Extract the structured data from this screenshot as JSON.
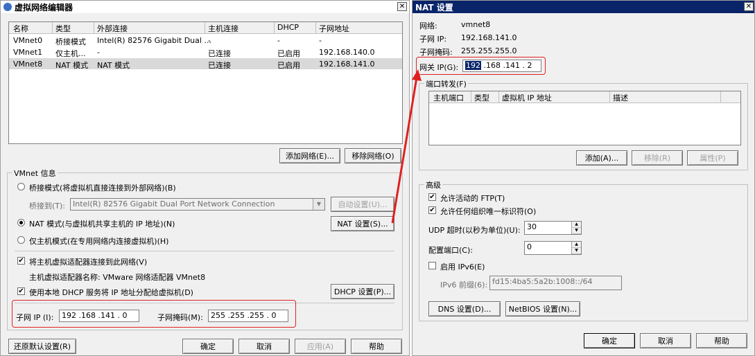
{
  "left_window": {
    "title": "虚拟网络编辑器",
    "close": "✕",
    "table": {
      "headers": [
        "名称",
        "类型",
        "外部连接",
        "主机连接",
        "DHCP",
        "子网地址"
      ],
      "rows": [
        [
          "VMnet0",
          "桥接模式",
          "Intel(R) 82576 Gigabit Dual ...",
          "-",
          "-",
          "-"
        ],
        [
          "VMnet1",
          "仅主机...",
          "-",
          "已连接",
          "已启用",
          "192.168.140.0"
        ],
        [
          "VMnet8",
          "NAT 模式",
          "NAT 模式",
          "已连接",
          "已启用",
          "192.168.141.0"
        ]
      ]
    },
    "add_network": "添加网络(E)...",
    "remove_network": "移除网络(O)",
    "vmnet_info": "VMnet 信息",
    "bridged_mode": "桥接模式(将虚拟机直接连接到外部网络)(B)",
    "bridged_to_label": "桥接到(T):",
    "bridged_to_value": "Intel(R) 82576 Gigabit Dual Port Network Connection",
    "auto_settings": "自动设置(U)...",
    "nat_mode": "NAT 模式(与虚拟机共享主机的 IP 地址)(N)",
    "nat_settings": "NAT 设置(S)...",
    "host_only": "仅主机模式(在专用网络内连接虚拟机)(H)",
    "connect_adapter": "将主机虚拟适配器连接到此网络(V)",
    "adapter_name": "主机虚拟适配器名称: VMware 网络适配器 VMnet8",
    "use_dhcp": "使用本地 DHCP 服务将 IP 地址分配给虚拟机(D)",
    "dhcp_settings": "DHCP 设置(P)...",
    "subnet_ip_label": "子网 IP (I):",
    "subnet_ip": "192 .168 .141 .  0",
    "subnet_mask_label": "子网掩码(M):",
    "subnet_mask": "255 .255 .255 .  0",
    "restore": "还原默认设置(R)",
    "ok": "确定",
    "cancel": "取消",
    "apply": "应用(A)",
    "help": "帮助"
  },
  "right_window": {
    "title": "NAT 设置",
    "close": "✕",
    "network_label": "网络:",
    "network_value": "vmnet8",
    "subnet_ip_label": "子网 IP:",
    "subnet_ip_value": "192.168.141.0",
    "subnet_mask_label": "子网掩码:",
    "subnet_mask_value": "255.255.255.0",
    "gateway_label": "网关 IP(G):",
    "gateway_first": "192",
    "gateway_rest": " .168 .141 .  2",
    "port_forwarding": "端口转发(F)",
    "pf_headers": [
      "主机端口",
      "类型",
      "虚拟机 IP 地址",
      "描述"
    ],
    "add": "添加(A)...",
    "remove": "移除(R)",
    "properties": "属性(P)",
    "advanced": "高级",
    "allow_ftp": "允许活动的 FTP(T)",
    "allow_oui": "允许任何组织唯一标识符(O)",
    "udp_timeout_label": "UDP 超时(以秒为单位)(U):",
    "udp_timeout": "30",
    "config_port_label": "配置端口(C):",
    "config_port": "0",
    "enable_ipv6": "启用 IPv6(E)",
    "ipv6_prefix_label": "IPv6 前缀(6):",
    "ipv6_prefix": "fd15:4ba5:5a2b:1008::/64",
    "dns_settings": "DNS 设置(D)...",
    "netbios_settings": "NetBIOS 设置(N)...",
    "ok": "确定",
    "cancel": "取消",
    "help": "帮助"
  },
  "colors": {
    "annotation": "#e02020",
    "nat_title_bg": "#0a246a"
  }
}
